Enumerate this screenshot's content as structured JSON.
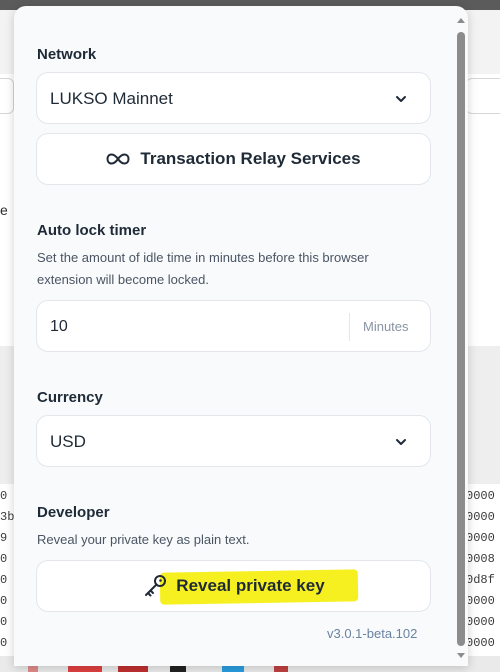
{
  "background": {
    "fragment_text": "e",
    "left_strip": [
      "0",
      "3b",
      "9",
      "0",
      "0",
      "0",
      "0",
      "0"
    ],
    "right_strip": [
      "0000",
      "0000",
      "0000",
      "0008",
      "0d8f",
      "0000",
      "0000",
      "0000"
    ]
  },
  "network": {
    "title": "Network",
    "selected": "LUKSO Mainnet",
    "relay_button_label": "Transaction Relay Services"
  },
  "auto_lock": {
    "title": "Auto lock timer",
    "description": "Set the amount of idle time in minutes before this browser extension will become locked.",
    "value": "10",
    "unit": "Minutes"
  },
  "currency": {
    "title": "Currency",
    "selected": "USD"
  },
  "developer": {
    "title": "Developer",
    "description": "Reveal your private key as plain text.",
    "reveal_button_label": "Reveal private key"
  },
  "version": "v3.0.1-beta.102",
  "colors": {
    "highlight": "#f7f020",
    "text_primary": "#1f2a37",
    "version_text": "#6b83a3"
  },
  "icons": {
    "relay": "infinity-icon",
    "reveal": "key-icon",
    "select": "chevron-down-icon"
  }
}
